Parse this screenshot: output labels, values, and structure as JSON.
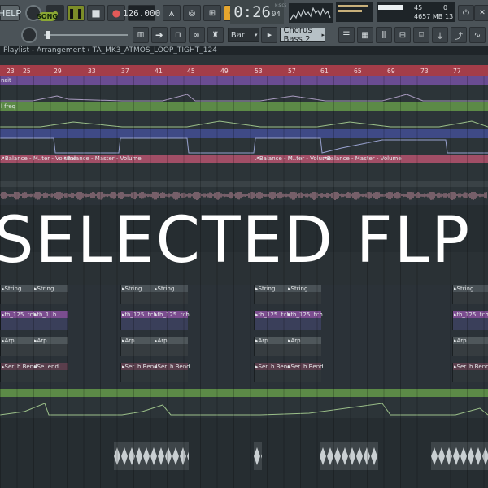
{
  "toolbar": {
    "help_label": "HELP",
    "song_label": "SONG",
    "tempo": "126.000",
    "time_main": "0:26",
    "time_sub": "94",
    "time_unit": "M:S:CS",
    "cpu_voices": "45",
    "memory": "4657 MB",
    "polyphony": "13",
    "cpu_small": "0",
    "snap_value": "Bar",
    "preset_name": "Chorus Bass 2",
    "tempo_unit": "≈"
  },
  "breadcrumb": {
    "text": "Playlist - Arrangement › TA_MK3_ATMOS_LOOP_TIGHT_124"
  },
  "ruler": {
    "numbers": [
      "23",
      "25",
      "29",
      "33",
      "37",
      "41",
      "45",
      "49",
      "53",
      "57",
      "61",
      "65",
      "69",
      "73",
      "77"
    ]
  },
  "tracks": {
    "lane1_label": "nsit",
    "lane2_label": "l freq",
    "volume_labels": [
      "Balance - M..ter - Volume",
      "Balance - Master - Volume",
      "Balance - M..ter - Volume",
      "Balance - Master - Volume"
    ],
    "string_labels": [
      "String",
      "String",
      "String",
      "String",
      "String",
      "String",
      "String"
    ],
    "fh_labels": [
      "fh_125..tch",
      "fh_1..h",
      "fh_125..tch",
      "fh_125..tch",
      "fh_125..tch",
      "fh_125..tch",
      "fh_125..tch",
      "fh_125..tch"
    ],
    "arp_labels": [
      "Arp",
      "Arp",
      "Arp",
      "Arp",
      "Arp",
      "Arp",
      "Arp",
      "Arp"
    ],
    "bend_labels": [
      "Ser..h Bend",
      "Se..end",
      "Ser..h Bend",
      "Ser..h Bend",
      "Ser..h Bend",
      "Ser..h Bend",
      "Ser..h Bend",
      "Se..end",
      "Ser..h Bend"
    ]
  },
  "overlay": {
    "title": "SELECTED FLP"
  },
  "colors": {
    "ruler": "#a43d49",
    "purple_lane": "#6a4c92",
    "green_lane": "#5c8a47",
    "blue_lane": "#3f4a86",
    "volume_lane": "#a14e66",
    "pink_wave": "#c08a9a"
  }
}
